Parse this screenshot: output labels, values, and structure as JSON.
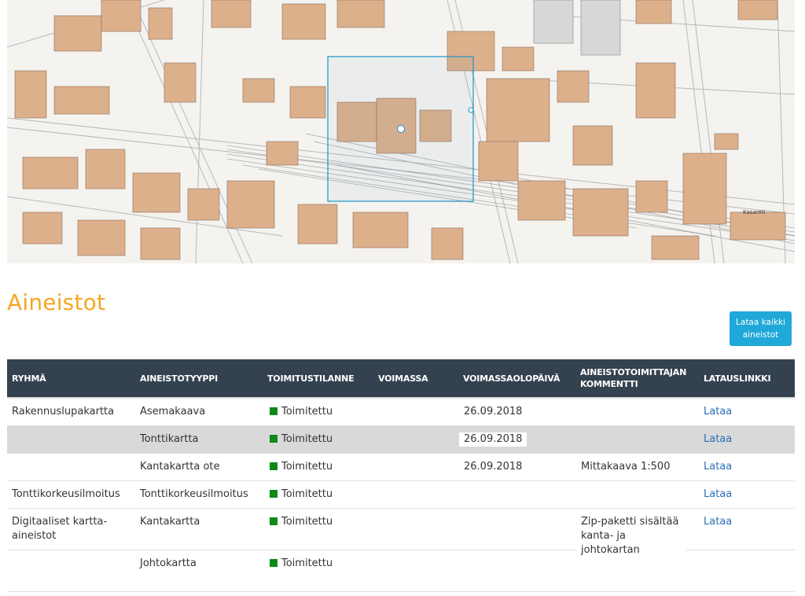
{
  "map": {
    "label": "Kasarmi"
  },
  "section_title": "Aineistot",
  "download_all_label": "Lataa kaikki aineistot",
  "table": {
    "headers": [
      "RYHMÄ",
      "AINEISTOTYYPPI",
      "TOIMITUSTILANNE",
      "VOIMASSA",
      "VOIMASSAOLOPÄIVÄ",
      "AINEISTOTOIMITTAJAN KOMMENTTI",
      "LATAUSLINKKI"
    ],
    "rows": [
      {
        "group": "Rakennuslupakartta",
        "type": "Asemakaava",
        "status": "Toimitettu",
        "valid": "",
        "date": "26.09.2018",
        "comment": "",
        "link": "Lataa"
      },
      {
        "group": "",
        "type": "Tonttikartta",
        "status": "Toimitettu",
        "valid": "",
        "date": "26.09.2018",
        "comment": "",
        "link": "Lataa"
      },
      {
        "group": "",
        "type": "Kantakartta ote",
        "status": "Toimitettu",
        "valid": "",
        "date": "26.09.2018",
        "comment": "Mittakaava 1:500",
        "link": "Lataa"
      },
      {
        "group": "Tonttikorkeusilmoitus",
        "type": "Tonttikorkeusilmoitus",
        "status": "Toimitettu",
        "valid": "",
        "date": "",
        "comment": "",
        "link": "Lataa"
      },
      {
        "group": "Digitaaliset kartta-aineistot",
        "type": "Kantakartta",
        "status": "Toimitettu",
        "valid": "",
        "date": "",
        "comment": "Zip-paketti sisältää kanta- ja johtokartan",
        "link": "Lataa"
      },
      {
        "group": "",
        "type": "Johtokartta",
        "status": "Toimitettu",
        "valid": "",
        "date": "",
        "comment": "",
        "link": ""
      }
    ]
  },
  "colors": {
    "title": "#f5a623",
    "header_bg": "#34424f",
    "button_bg": "#1fa8d8",
    "status": "#0c8a1a",
    "link": "#2b6fb5",
    "building": "#ddb08c"
  }
}
